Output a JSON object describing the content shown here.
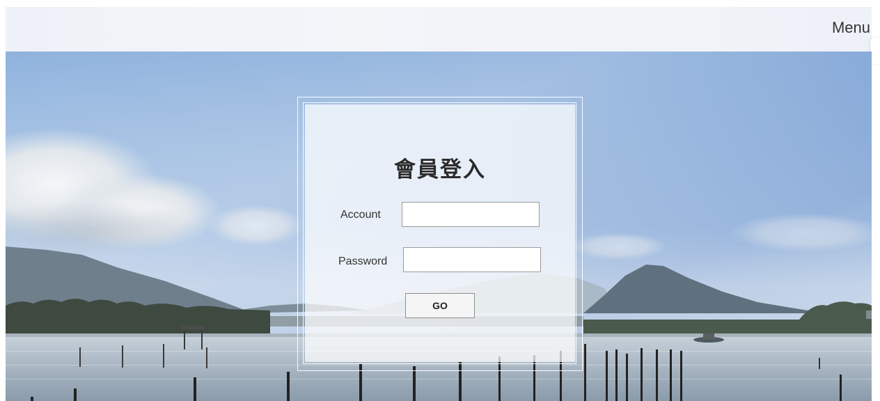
{
  "topbar": {
    "menu_label": "Menu"
  },
  "login": {
    "title": "會員登入",
    "account_label": "Account",
    "account_value": "",
    "password_label": "Password",
    "password_value": "",
    "submit_label": "GO"
  },
  "colors": {
    "topbar_bg": "#eef2f8",
    "sky_top": "#7ea4d4",
    "water": "#a9b7c6",
    "panel_bg": "#ffffff"
  }
}
